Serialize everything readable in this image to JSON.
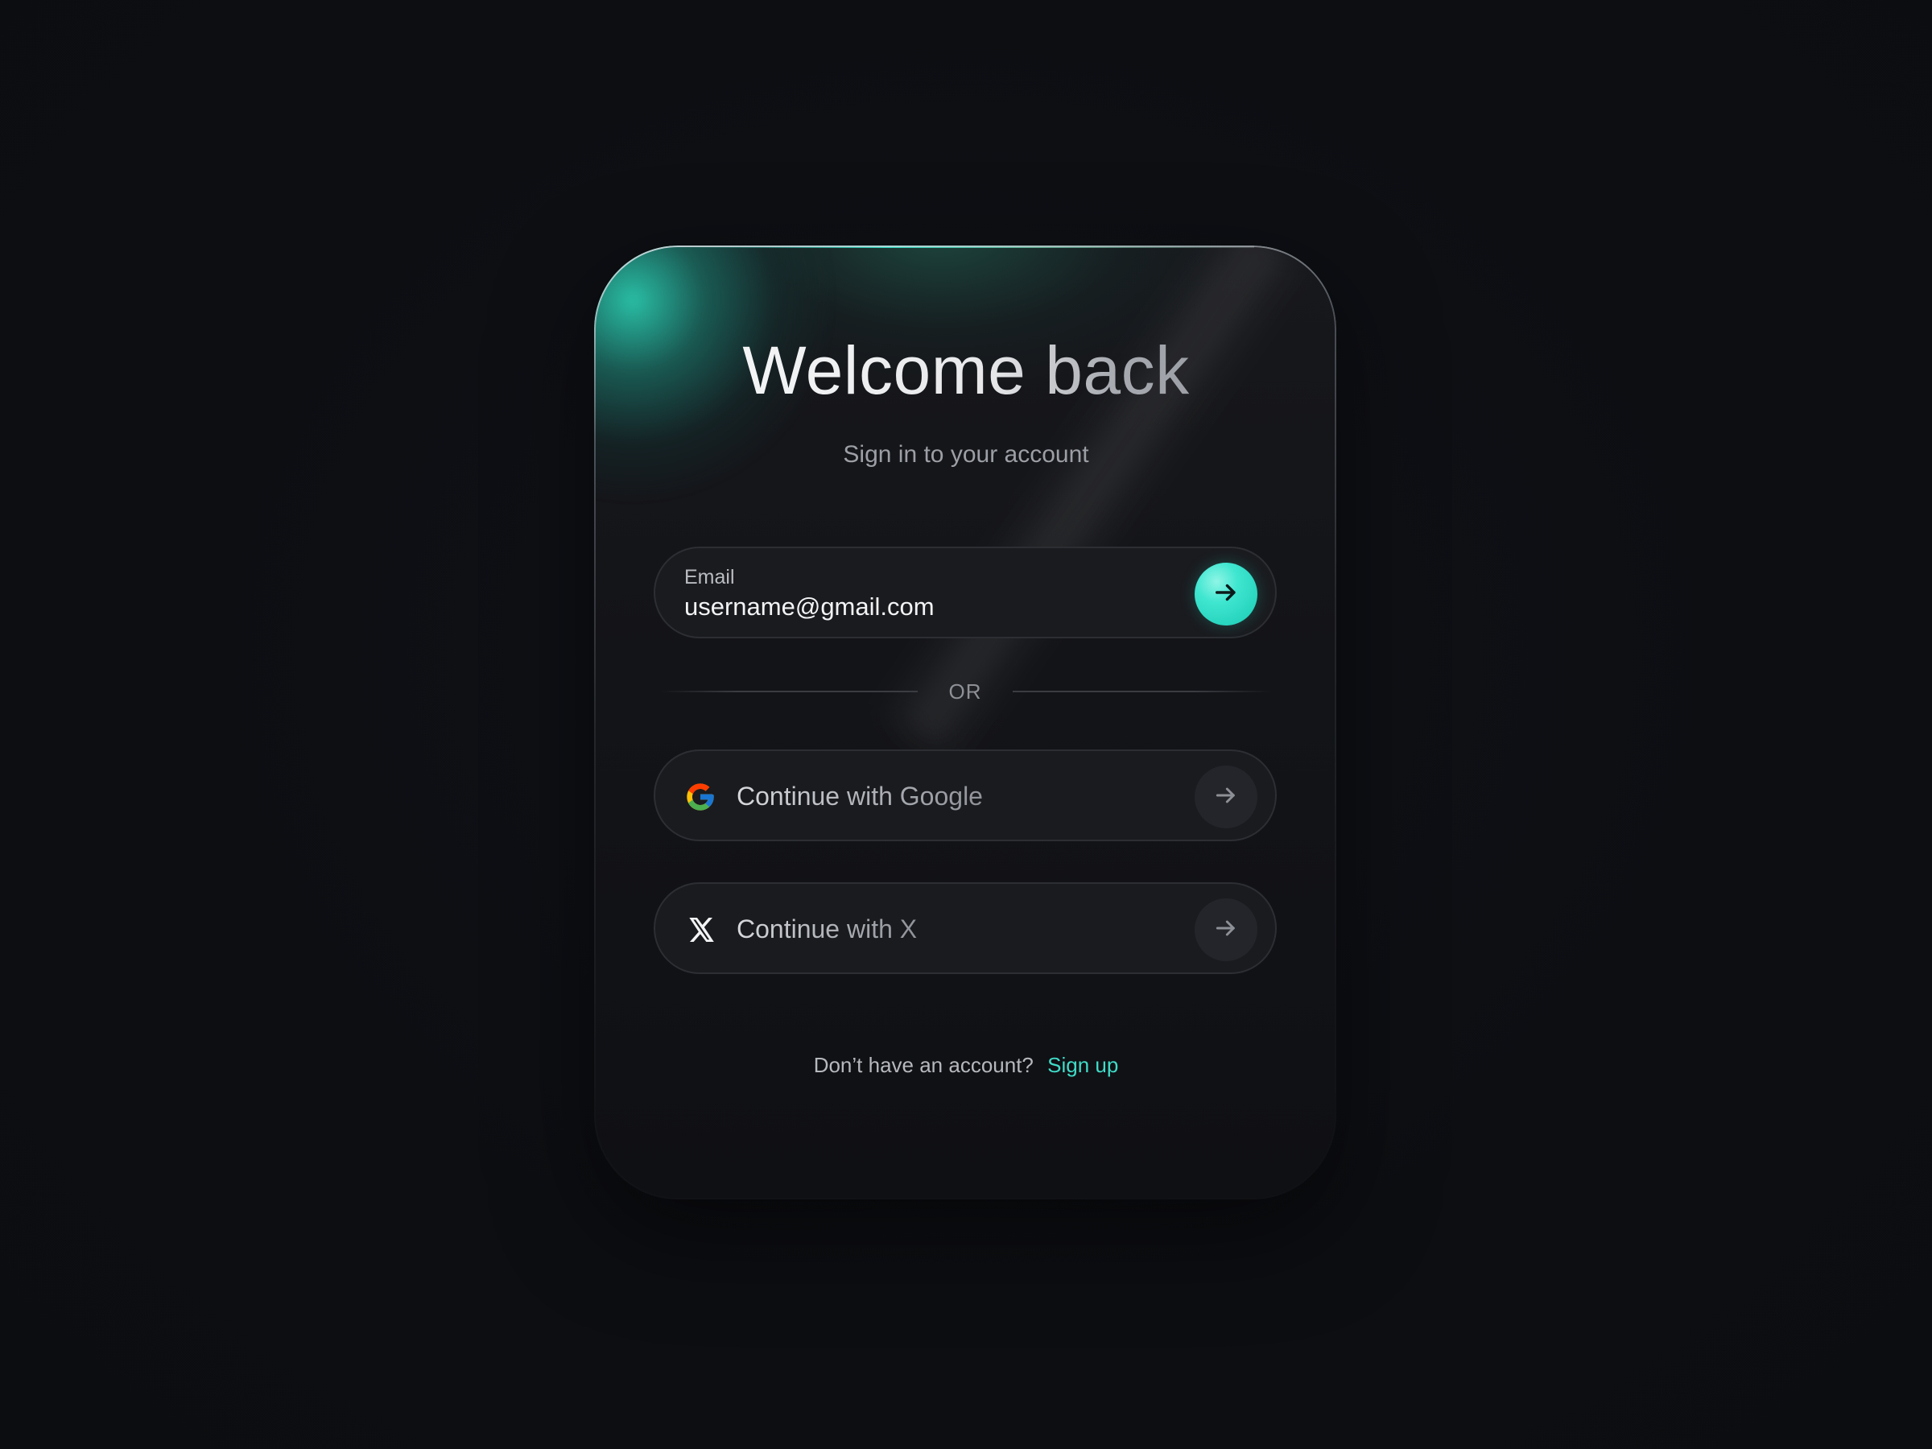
{
  "header": {
    "title": "Welcome back",
    "subtitle": "Sign in to your account"
  },
  "email": {
    "label": "Email",
    "value": "username@gmail.com",
    "submit_icon": "arrow-right-icon"
  },
  "divider": {
    "label": "OR"
  },
  "social": [
    {
      "label": "Continue with Google",
      "icon": "google-icon"
    },
    {
      "label": "Continue with X",
      "icon": "x-logo-icon"
    }
  ],
  "footer": {
    "prompt": "Don’t have an account?",
    "link_label": "Sign up"
  },
  "colors": {
    "background": "#0c0e12",
    "accent": "#3fdcc7",
    "card": "#17181c"
  }
}
